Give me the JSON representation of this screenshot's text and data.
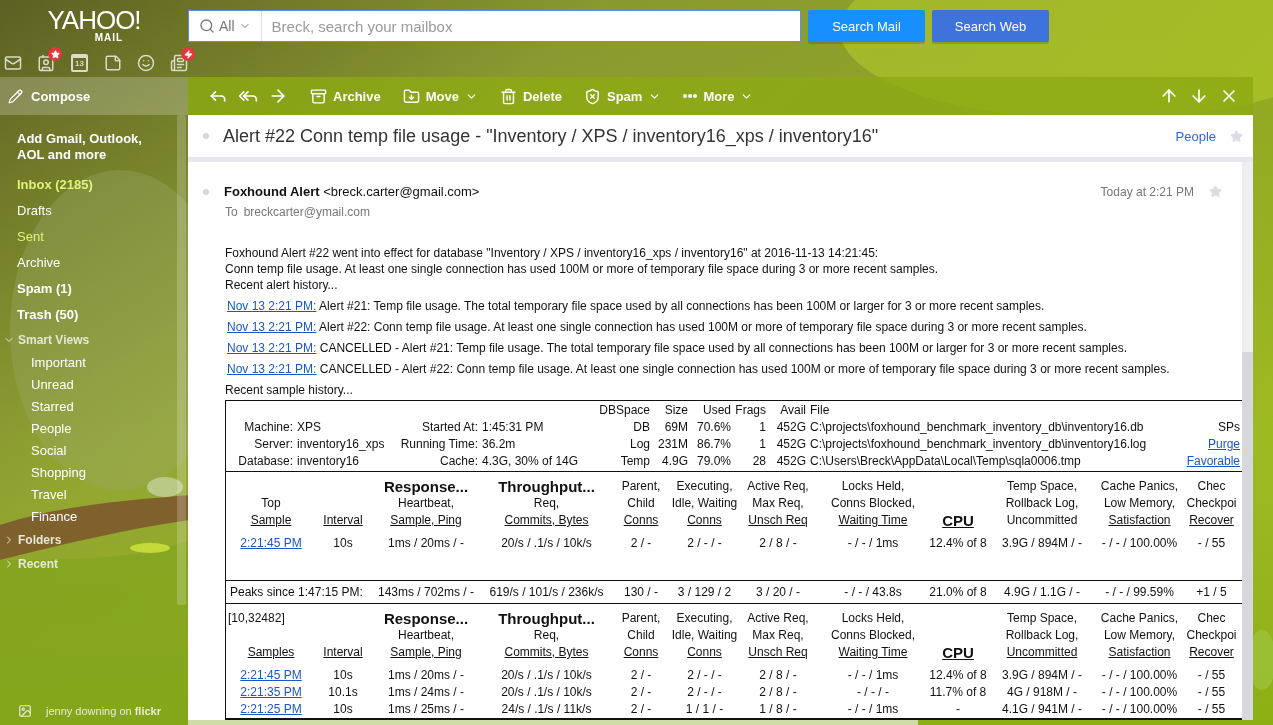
{
  "brand": {
    "name": "YAHOO!",
    "product": "MAIL"
  },
  "apps": [
    {
      "kind": "mail",
      "badge": false
    },
    {
      "kind": "contacts",
      "badge": true
    },
    {
      "kind": "calendar",
      "badge": false,
      "day": "13"
    },
    {
      "kind": "notepad",
      "badge": false
    },
    {
      "kind": "messenger",
      "badge": false
    },
    {
      "kind": "news",
      "badge": true
    }
  ],
  "search": {
    "scope": "All",
    "placeholder": "Breck, search your mailbox",
    "buttons": [
      {
        "label": "Search Mail",
        "primary": true
      },
      {
        "label": "Search Web",
        "primary": false
      }
    ]
  },
  "sidebar": {
    "compose": "Compose",
    "add_accounts": "Add Gmail, Outlook, AOL and more",
    "folders": [
      {
        "label": "Inbox (2185)",
        "highlighted": true,
        "bold": true
      },
      {
        "label": "Drafts",
        "highlighted": false,
        "bold": false
      },
      {
        "label": "Sent",
        "highlighted": true,
        "bold": false
      },
      {
        "label": "Archive",
        "highlighted": false,
        "bold": false
      },
      {
        "label": "Spam (1)",
        "highlighted": false,
        "bold": true
      },
      {
        "label": "Trash (50)",
        "highlighted": false,
        "bold": true
      }
    ],
    "groups": [
      {
        "label": "Smart Views",
        "expanded": true,
        "children": [
          {
            "label": "Important"
          },
          {
            "label": "Unread"
          },
          {
            "label": "Starred"
          },
          {
            "label": "People"
          },
          {
            "label": "Social"
          },
          {
            "label": "Shopping"
          },
          {
            "label": "Travel"
          },
          {
            "label": "Finance"
          }
        ]
      },
      {
        "label": "Folders",
        "expanded": false
      },
      {
        "label": "Recent",
        "expanded": false
      }
    ],
    "credit": "jenny downing on **flickr**"
  },
  "toolbar": {
    "actions": [
      {
        "kind": "archive",
        "label": "Archive",
        "menu": false
      },
      {
        "kind": "move",
        "label": "Move",
        "menu": true
      },
      {
        "kind": "delete",
        "label": "Delete",
        "menu": false
      },
      {
        "kind": "spam",
        "label": "Spam",
        "menu": true
      },
      {
        "kind": "more",
        "label": "More",
        "menu": true
      }
    ]
  },
  "message": {
    "subject": "Alert #22 Conn temp file usage - \"Inventory / XPS / inventory16_xps / inventory16\"",
    "people_link": "People",
    "sender_name": "Foxhound Alert",
    "sender_email": "<breck.carter@gmail.com>",
    "time": "Today at 2:21 PM",
    "to_label": "To",
    "to": "breckcarter@ymail.com",
    "intro": [
      "Foxhound Alert #22 went into effect for database \"Inventory / XPS / inventory16_xps / inventory16\" at 2016-11-13 14:21:45:",
      "Conn temp file usage. At least one single connection has used 100M or more of temporary file space during 3 or more recent samples.",
      "Recent alert history..."
    ],
    "history": [
      {
        "date": "Nov 13 2:21 PM:",
        "text": "Alert #21: Temp file usage. The total temporary file space used by all connections has been 100M or larger for 3 or more recent samples."
      },
      {
        "date": "Nov 13 2:21 PM:",
        "text": "Alert #22: Conn temp file usage. At least one single connection has used 100M or more of temporary file space during 3 or more recent samples."
      },
      {
        "date": "Nov 13 2:21 PM:",
        "text": "CANCELLED - Alert #21: Temp file usage. The total temporary file space used by all connections has been 100M or larger for 3 or more recent samples."
      },
      {
        "date": "Nov 13 2:21 PM:",
        "text": "CANCELLED - Alert #22: Conn temp file usage. At least one single connection has used 100M or more of temporary file space during 3 or more recent samples."
      }
    ],
    "history_tail": "Recent sample history..."
  },
  "sample_history": {
    "server": [
      [
        {
          "label": "Machine:",
          "value": "XPS"
        },
        {
          "label": "Started At:",
          "value": "1:45:31 PM"
        }
      ],
      [
        {
          "label": "Server:",
          "value": "inventory16_xps"
        },
        {
          "label": "Running Time:",
          "value": "36.2m"
        }
      ],
      [
        {
          "label": "Database:",
          "value": "inventory16"
        },
        {
          "label": "Cache:",
          "value": "4.3G, 30% of 14G"
        }
      ]
    ],
    "dbspace_columns": [
      "DBSpace",
      "Size",
      "Used",
      "Frags",
      "Avail",
      "File"
    ],
    "dbspace_rows": [
      [
        "DB",
        "69M",
        "70.6%",
        "1",
        "452G",
        "C:\\projects\\foxhound_benchmark_inventory_db\\inventory16.db"
      ],
      [
        "Log",
        "231M",
        "86.7%",
        "1",
        "452G",
        "C:\\projects\\foxhound_benchmark_inventory_db\\inventory16.log"
      ],
      [
        "Temp",
        "4.9G",
        "79.0%",
        "28",
        "452G",
        "C:\\Users\\Breck\\AppData\\Local\\Temp\\sqla0006.tmp"
      ]
    ],
    "sps": {
      "label": "SPs",
      "links": [
        "Purge",
        "Favorable"
      ]
    },
    "tables": [
      {
        "columns": [
          {
            "lines": [
              "Top",
              "Sample"
            ],
            "underlined": true
          },
          {
            "lines": [
              "Interval"
            ],
            "underlined": true
          },
          {
            "heading": "Response...",
            "lines": [
              "Heartbeat,",
              "Sample, Ping"
            ],
            "underlined": true
          },
          {
            "heading": "Throughput...",
            "lines": [
              "Req,",
              "Commits, Bytes"
            ],
            "underlined": true
          },
          {
            "lines": [
              "Parent,",
              "Child",
              "Conns"
            ],
            "underlined": true
          },
          {
            "lines": [
              "Executing,",
              "Idle, Waiting",
              "Conns"
            ],
            "underlined": true
          },
          {
            "lines": [
              "Active Req,",
              "Max Req,",
              "Unsch Req"
            ],
            "underlined": true
          },
          {
            "lines": [
              "Locks Held,",
              "Conns Blocked,",
              "Waiting Time"
            ],
            "underlined": true
          },
          {
            "kind": "major",
            "lines": [
              "CPU"
            ],
            "underlined": true
          },
          {
            "lines": [
              "Temp Space,",
              "Rollback Log,",
              "Uncommitted"
            ],
            "underlined": false
          },
          {
            "lines": [
              "Cache Panics,",
              "Low Memory,",
              "Satisfaction"
            ],
            "underlined": true
          },
          {
            "lines": [
              "Chec",
              "Checkpoi",
              "Recover"
            ],
            "underlined": true
          }
        ],
        "rows": [
          [
            "2:21:45 PM",
            "10s",
            "1ms / 20ms / -",
            "20/s / .1/s / 10k/s",
            "2 / -",
            "2 / - / -",
            "2 / 8 / -",
            "- / - / 1ms",
            "12.4% of 8",
            "3.9G / 894M / -",
            "- / - / 100.00%",
            "- / 55"
          ]
        ]
      },
      {
        "kind": "peaks",
        "label": "Peaks since 1:47:15 PM:",
        "values": [
          "143ms / 702ms / -",
          "619/s / 101/s / 236k/s",
          "130 / -",
          "3 / 129 / 2",
          "3 / 20 / -",
          "- / - / 43.8s",
          "21.0% of 8",
          "4.9G / 1.1G / -",
          "- / - / 99.59%",
          "+1 / 5"
        ]
      },
      {
        "corner": "[10,32482]",
        "columns": [
          {
            "lines": [
              "Samples"
            ],
            "underlined": true
          },
          {
            "lines": [
              "Interval"
            ],
            "underlined": true
          },
          {
            "heading": "Response...",
            "lines": [
              "Heartbeat,",
              "Sample, Ping"
            ],
            "underlined": true
          },
          {
            "heading": "Throughput...",
            "lines": [
              "Req,",
              "Commits, Bytes"
            ],
            "underlined": true
          },
          {
            "lines": [
              "Parent,",
              "Child",
              "Conns"
            ],
            "underlined": true
          },
          {
            "lines": [
              "Executing,",
              "Idle, Waiting",
              "Conns"
            ],
            "underlined": true
          },
          {
            "lines": [
              "Active Req,",
              "Max Req,",
              "Unsch Req"
            ],
            "underlined": true
          },
          {
            "lines": [
              "Locks Held,",
              "Conns Blocked,",
              "Waiting Time"
            ],
            "underlined": true
          },
          {
            "kind": "major",
            "lines": [
              "CPU"
            ],
            "underlined": true
          },
          {
            "lines": [
              "Temp Space,",
              "Rollback Log,",
              "Uncommitted"
            ],
            "underlined": true
          },
          {
            "lines": [
              "Cache Panics,",
              "Low Memory,",
              "Satisfaction"
            ],
            "underlined": true
          },
          {
            "lines": [
              "Chec",
              "Checkpoi",
              "Recover"
            ],
            "underlined": true
          }
        ],
        "rows": [
          [
            "2:21:45 PM",
            "10s",
            "1ms / 20ms / -",
            "20/s / .1/s / 10k/s",
            "2 / -",
            "2 / - / -",
            "2 / 8 / -",
            "- / - / 1ms",
            "12.4% of 8",
            "3.9G / 894M / -",
            "- / - / 100.00%",
            "- / 55"
          ],
          [
            "2:21:35 PM",
            "10.1s",
            "1ms / 24ms / -",
            "20/s / .1/s / 10k/s",
            "2 / -",
            "2 / - / -",
            "2 / 8 / -",
            "- / - / -",
            "11.7% of 8",
            "4G / 918M / -",
            "- / - / 100.00%",
            "- / 55"
          ],
          [
            "2:21:25 PM",
            "10s",
            "1ms / 25ms / -",
            "24/s / .1/s / 11k/s",
            "2 / -",
            "1 / 1 / -",
            "1 / 8 / -",
            "- / - / 1ms",
            "-",
            "4.1G / 941M / -",
            "- / - / 100.00%",
            "- / 55"
          ]
        ]
      }
    ]
  }
}
